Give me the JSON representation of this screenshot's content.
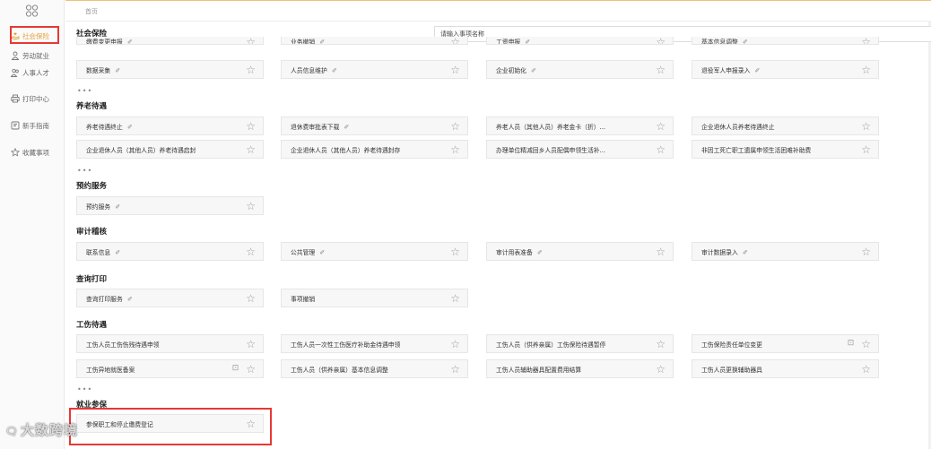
{
  "sidebar": {
    "items": [
      {
        "label": "社会保险",
        "icon": "heart-hand-icon",
        "active": true
      },
      {
        "label": "劳动就业",
        "icon": "user-icon"
      },
      {
        "label": "人事人才",
        "icon": "users-icon"
      },
      {
        "label": "打印中心",
        "icon": "printer-icon"
      },
      {
        "label": "新手指南",
        "icon": "guide-icon"
      },
      {
        "label": "收藏事项",
        "icon": "star-icon"
      }
    ]
  },
  "breadcrumb": "首页",
  "search": {
    "placeholder": "请输入事项名称"
  },
  "sections": [
    {
      "title": "社会保险",
      "rows": [
        [
          "缴费变更申报",
          "业务撤销",
          "工资申报",
          "基本信息调整"
        ],
        [
          "数据采集",
          "人员信息维护",
          "企业初始化",
          "退役军人申报录入"
        ]
      ],
      "more": "•••"
    },
    {
      "title": "养老待遇",
      "rows": [
        [
          "养老待遇终止",
          "退休费审批表下载",
          "养老人员（其他人员）养老金卡（折）...",
          "企业退休人员养老待遇终止"
        ],
        [
          "企业退休人员（其他人员）养老待遇启封",
          "企业退休人员（其他人员）养老待遇封存",
          "办理单位精减回乡人员配偶申领生活补...",
          "非因工死亡职工遗属申领生活困难补助费"
        ]
      ],
      "more": "•••"
    },
    {
      "title": "预约服务",
      "rows": [
        [
          "预约服务"
        ]
      ]
    },
    {
      "title": "审计稽核",
      "rows": [
        [
          "联系信息",
          "公共管理",
          "审计用表准备",
          "审计数据录入"
        ]
      ]
    },
    {
      "title": "查询打印",
      "rows": [
        [
          "查询打印服务",
          "事项撤销"
        ]
      ]
    },
    {
      "title": "工伤待遇",
      "rows": [
        [
          "工伤人员工伤伤残待遇申领",
          "工伤人员一次性工伤医疗补助金待遇申领",
          "工伤人员（供养亲属）工伤保险待遇暂停",
          "工伤保险责任单位变更"
        ],
        [
          "工伤异地就医备案",
          "工伤人员（供养亲属）基本信息调整",
          "工伤人员辅助器具配置费用结算",
          "工伤人员更换辅助器具"
        ]
      ],
      "more": "•••"
    },
    {
      "title": "就业参保",
      "rows": [
        [
          "参保职工和停止缴费登记"
        ]
      ]
    }
  ],
  "edit_glyph": "✐",
  "star_glyph": "☆",
  "doc_glyph": "⊡",
  "watermark": "大数跨境"
}
